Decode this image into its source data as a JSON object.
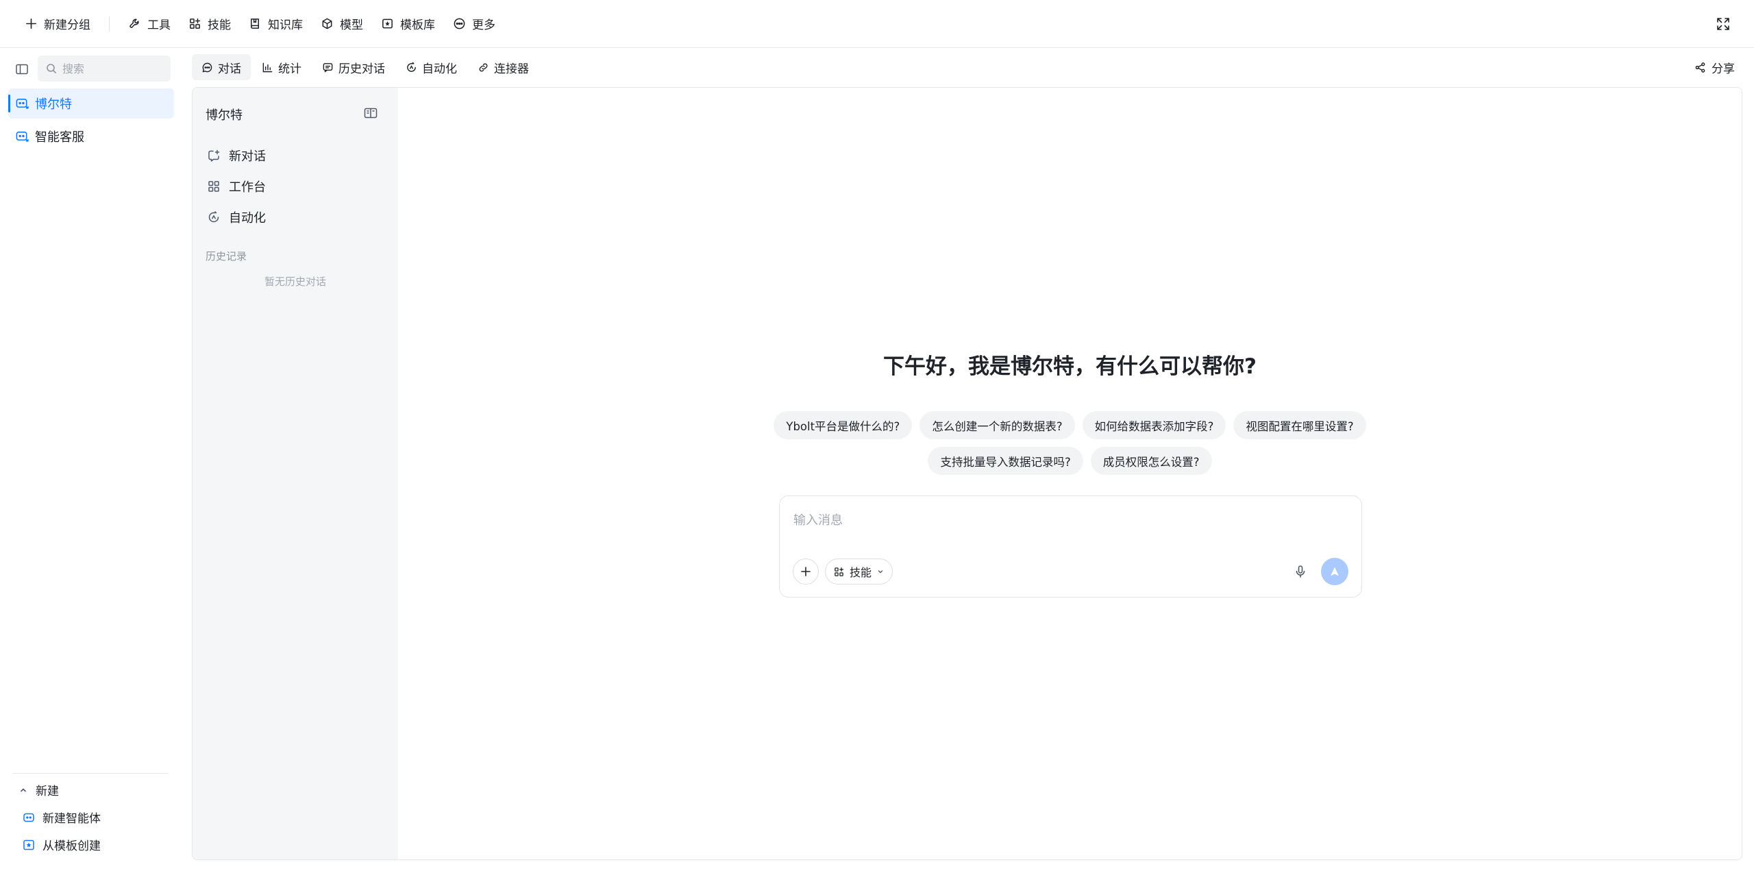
{
  "toolbar": {
    "new_group": "新建分组",
    "items": [
      {
        "label": "工具",
        "icon": "wrench-icon"
      },
      {
        "label": "技能",
        "icon": "skills-icon"
      },
      {
        "label": "知识库",
        "icon": "book-icon"
      },
      {
        "label": "模型",
        "icon": "cube-icon"
      },
      {
        "label": "模板库",
        "icon": "template-icon"
      },
      {
        "label": "更多",
        "icon": "more-icon"
      }
    ]
  },
  "sidebar": {
    "search_placeholder": "搜索",
    "agents": [
      {
        "label": "博尔特",
        "active": true
      },
      {
        "label": "智能客服",
        "active": false
      }
    ],
    "new_section": {
      "toggle_label": "新建",
      "items": [
        {
          "label": "新建智能体",
          "icon": "robot-icon"
        },
        {
          "label": "从模板创建",
          "icon": "template-icon"
        }
      ]
    }
  },
  "tabs": [
    {
      "label": "对话",
      "icon": "chat-icon",
      "active": true
    },
    {
      "label": "统计",
      "icon": "bar-chart-icon",
      "active": false
    },
    {
      "label": "历史对话",
      "icon": "history-chat-icon",
      "active": false
    },
    {
      "label": "自动化",
      "icon": "automation-icon",
      "active": false
    },
    {
      "label": "连接器",
      "icon": "link-icon",
      "active": false
    }
  ],
  "share_label": "分享",
  "history_pane": {
    "title": "博尔特",
    "nav": [
      {
        "label": "新对话",
        "icon": "new-chat-icon"
      },
      {
        "label": "工作台",
        "icon": "grid-icon"
      },
      {
        "label": "自动化",
        "icon": "automation-icon"
      }
    ],
    "section_label": "历史记录",
    "empty_text": "暂无历史对话"
  },
  "chat": {
    "greeting": "下午好，我是博尔特，有什么可以帮你?",
    "suggestions_row1": [
      "Ybolt平台是做什么的?",
      "怎么创建一个新的数据表?",
      "如何给数据表添加字段?",
      "视图配置在哪里设置?"
    ],
    "suggestions_row2": [
      "支持批量导入数据记录吗?",
      "成员权限怎么设置?"
    ],
    "input_placeholder": "输入消息",
    "skill_label": "技能"
  },
  "colors": {
    "accent": "#1677ff",
    "active_bg": "#eaf3ff",
    "send_button": "#a9c9ff",
    "pane_bg": "#f5f6f8",
    "chip_bg": "#f2f3f5"
  }
}
